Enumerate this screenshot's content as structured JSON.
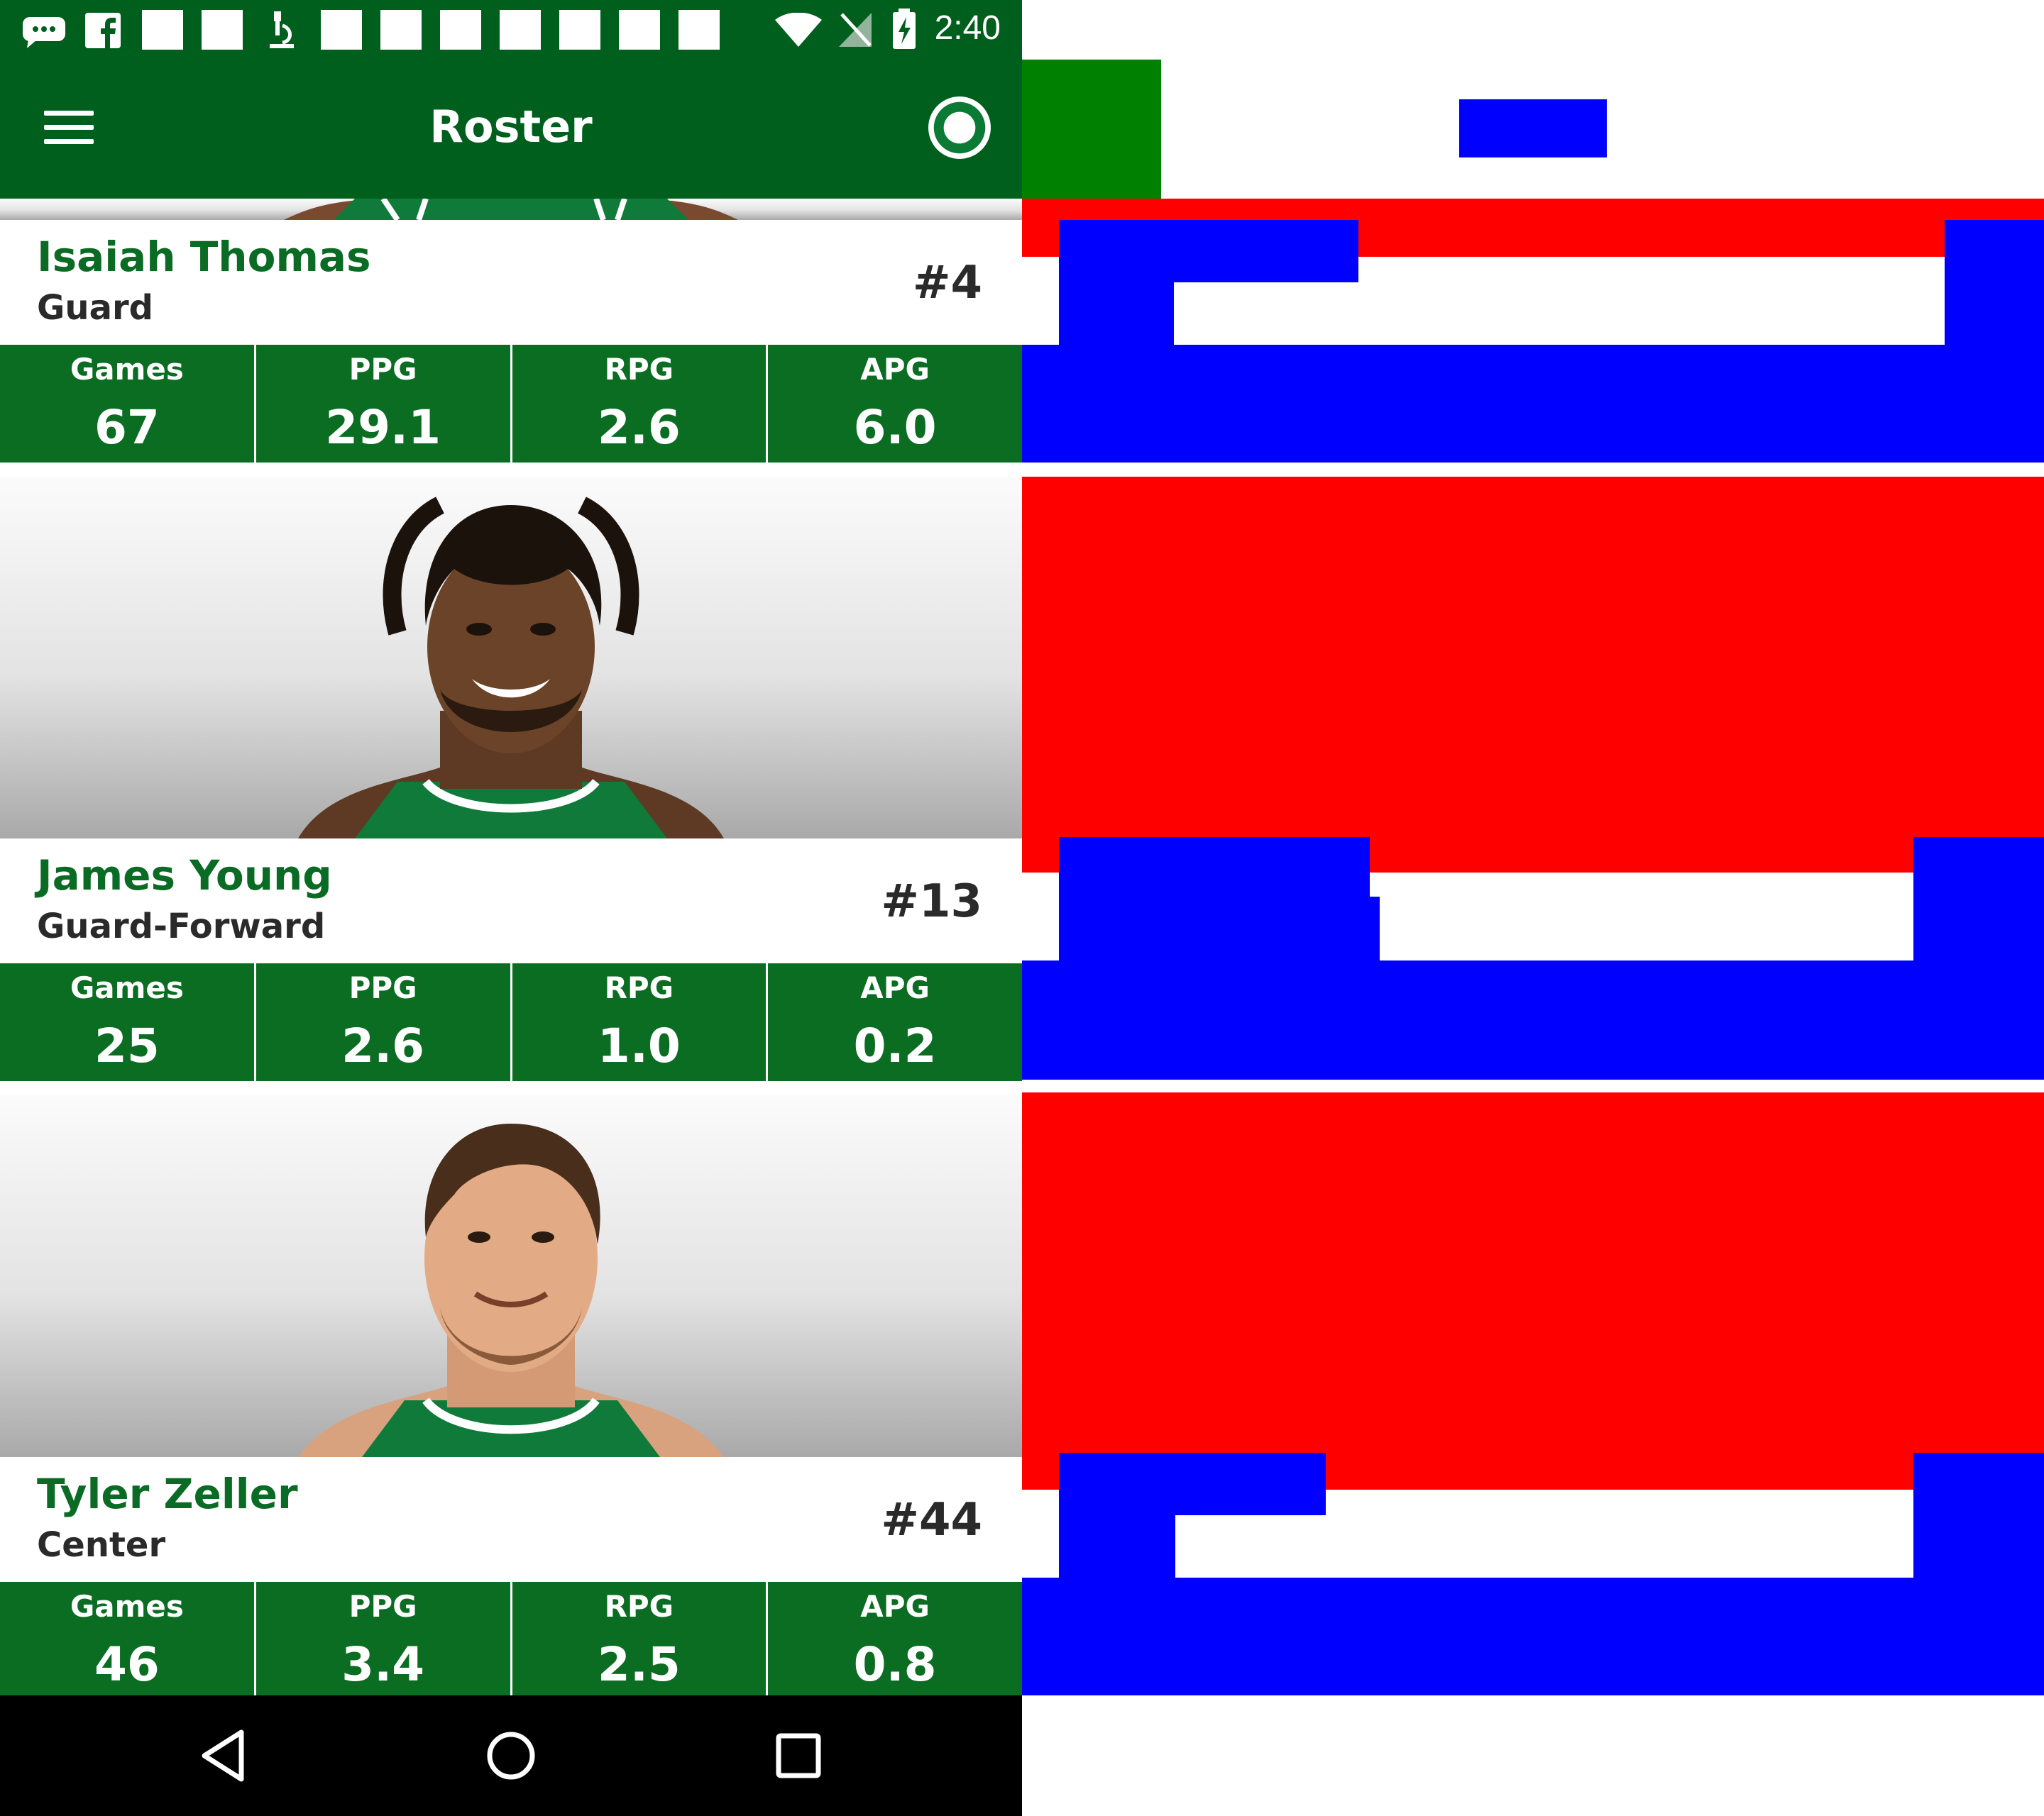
{
  "status_bar": {
    "time": "2:40",
    "left_icons": [
      "message-icon",
      "facebook-icon",
      "notification-placeholder",
      "notification-placeholder",
      "microscope-icon",
      "notification-placeholder",
      "notification-placeholder",
      "notification-placeholder",
      "notification-placeholder",
      "notification-placeholder",
      "notification-placeholder",
      "notification-placeholder"
    ],
    "right_icons": [
      "wifi-icon",
      "no-signal-icon",
      "battery-charging-icon"
    ]
  },
  "app_bar": {
    "title": "Roster",
    "color": "#005f1d"
  },
  "players": [
    {
      "name": "Isaiah Thomas",
      "position": "Guard",
      "number": "#4",
      "stats": [
        {
          "label": "Games",
          "value": "67"
        },
        {
          "label": "PPG",
          "value": "29.1"
        },
        {
          "label": "RPG",
          "value": "2.6"
        },
        {
          "label": "APG",
          "value": "6.0"
        }
      ]
    },
    {
      "name": "James Young",
      "position": "Guard-Forward",
      "number": "#13",
      "stats": [
        {
          "label": "Games",
          "value": "25"
        },
        {
          "label": "PPG",
          "value": "2.6"
        },
        {
          "label": "RPG",
          "value": "1.0"
        },
        {
          "label": "APG",
          "value": "0.2"
        }
      ]
    },
    {
      "name": "Tyler Zeller",
      "position": "Center",
      "number": "#44",
      "stats": [
        {
          "label": "Games",
          "value": "46"
        },
        {
          "label": "PPG",
          "value": "3.4"
        },
        {
          "label": "RPG",
          "value": "2.5"
        },
        {
          "label": "APG",
          "value": "0.8"
        }
      ]
    }
  ],
  "nav_bar": {
    "buttons": [
      "back-icon",
      "home-icon",
      "recents-icon"
    ]
  },
  "colors": {
    "brand_green": "#005f1d",
    "stats_green": "#0a6d22",
    "name_green": "#0a6b24"
  }
}
